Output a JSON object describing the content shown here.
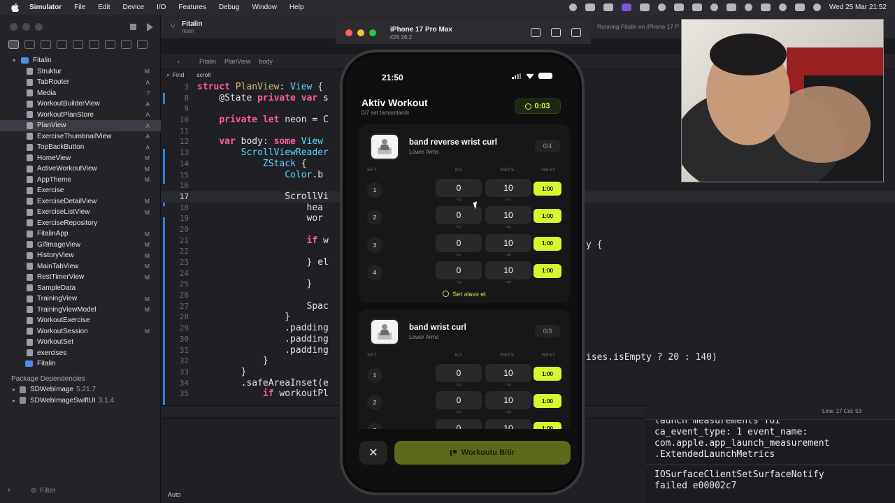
{
  "menubar": {
    "app": "Simulator",
    "items": [
      "File",
      "Edit",
      "Device",
      "I/O",
      "Features",
      "Debug",
      "Window",
      "Help"
    ],
    "clock": "Wed 25 Mar  21:52"
  },
  "xcode": {
    "scheme": "Fitalin",
    "branch": "main",
    "running_status": "Running Fitalin on iPhone 17 P",
    "find_label": "Find",
    "find_query": "scroll",
    "jump_path": [
      "Fitalin",
      "PlanView",
      "body"
    ],
    "project": "Fitalin",
    "files": [
      {
        "name": "Struktur",
        "badge": "M"
      },
      {
        "name": "TabRouter",
        "badge": "A"
      },
      {
        "name": "Media",
        "badge": "?"
      },
      {
        "name": "WorkoutBuilderView",
        "badge": "A"
      },
      {
        "name": "WorkoutPlanStore",
        "badge": "A"
      },
      {
        "name": "PlanView",
        "badge": "A"
      },
      {
        "name": "ExerciseThumbnailView",
        "badge": "A"
      },
      {
        "name": "TopBackButton",
        "badge": "A"
      },
      {
        "name": "HomeView",
        "badge": "M"
      },
      {
        "name": "ActiveWorkoutView",
        "badge": "M"
      },
      {
        "name": "AppTheme",
        "badge": "M"
      },
      {
        "name": "Exercise",
        "badge": ""
      },
      {
        "name": "ExerciseDetailView",
        "badge": "M"
      },
      {
        "name": "ExerciseListView",
        "badge": "M"
      },
      {
        "name": "ExerciseRepository",
        "badge": ""
      },
      {
        "name": "FitalinApp",
        "badge": "M"
      },
      {
        "name": "GifImageView",
        "badge": "M"
      },
      {
        "name": "HistoryView",
        "badge": "M"
      },
      {
        "name": "MainTabView",
        "badge": "M"
      },
      {
        "name": "RestTimerView",
        "badge": "M"
      },
      {
        "name": "SampleData",
        "badge": ""
      },
      {
        "name": "TrainingView",
        "badge": "M"
      },
      {
        "name": "TrainingViewModel",
        "badge": "M"
      },
      {
        "name": "WorkoutExercise",
        "badge": ""
      },
      {
        "name": "WorkoutSession",
        "badge": "M"
      },
      {
        "name": "WorkoutSet",
        "badge": ""
      },
      {
        "name": "exercises",
        "badge": ""
      },
      {
        "name": "Fitalin",
        "badge": ""
      }
    ],
    "packages_title": "Package Dependencies",
    "packages": [
      {
        "name": "SDWebImage",
        "version": "5.21.7"
      },
      {
        "name": "SDWebImageSwiftUI",
        "version": "3.1.4"
      }
    ],
    "filter_placeholder": "Filter",
    "auto_label": "Auto",
    "cursor_position": "Line: 17  Col: 53",
    "code": [
      {
        "n": "3",
        "t": "struct PlanView: View {"
      },
      {
        "n": "8",
        "t": "    @State private var s"
      },
      {
        "n": "9",
        "t": ""
      },
      {
        "n": "10",
        "t": "    private let neon = C"
      },
      {
        "n": "11",
        "t": ""
      },
      {
        "n": "12",
        "t": "    var body: some View"
      },
      {
        "n": "13",
        "t": "        ScrollViewReader"
      },
      {
        "n": "14",
        "t": "            ZStack {"
      },
      {
        "n": "15",
        "t": "                Color.b"
      },
      {
        "n": "16",
        "t": ""
      },
      {
        "n": "17",
        "t": "                ScrollVi"
      },
      {
        "n": "18",
        "t": "                    hea"
      },
      {
        "n": "19",
        "t": "                    wor"
      },
      {
        "n": "20",
        "t": ""
      },
      {
        "n": "21",
        "t": "                    if w"
      },
      {
        "n": "22",
        "t": ""
      },
      {
        "n": "23",
        "t": "                    } el"
      },
      {
        "n": "24",
        "t": ""
      },
      {
        "n": "25",
        "t": "                    }"
      },
      {
        "n": "26",
        "t": ""
      },
      {
        "n": "27",
        "t": "                    Spac"
      },
      {
        "n": "28",
        "t": "                }"
      },
      {
        "n": "29",
        "t": "                .padding"
      },
      {
        "n": "30",
        "t": "                .padding"
      },
      {
        "n": "31",
        "t": "                .padding"
      },
      {
        "n": "32",
        "t": "            }"
      },
      {
        "n": "33",
        "t": "        }"
      },
      {
        "n": "34",
        "t": "        .safeAreaInset(e"
      },
      {
        "n": "35",
        "t": "            if workoutPl"
      }
    ],
    "code_tail_21": "y {",
    "code_tail_31": "ises.isEmpty ? 20 : 140)"
  },
  "console": [
    "launch measurements TUI",
    "ca_event_type: 1 event_name:",
    "com.apple.app_launch_measurement",
    ".ExtendedLaunchMetrics",
    "IOSurfaceClientSetSurfaceNotify",
    "failed e00002c7"
  ],
  "simulator": {
    "device": "iPhone 17 Pro Max",
    "os": "iOS 26.2"
  },
  "app": {
    "status_time": "21:50",
    "title": "Aktiv Workout",
    "progress_text": "0/7 set tamamlandı",
    "timer": "0:03",
    "column_headers": {
      "set": "SET",
      "kg": "KG",
      "reps": "REPS",
      "rest": "REST"
    },
    "unit_kg": "kg",
    "unit_rep": "rep",
    "add_set_label": "Set əlavə et",
    "finish_label": "Workoutu Bitir",
    "close_label": "✕",
    "exercises": [
      {
        "name": "band reverse wrist curl",
        "muscle": "Lower Arms",
        "count": "0/4",
        "sets": [
          {
            "n": "1",
            "kg": "0",
            "reps": "10",
            "rest": "1:00"
          },
          {
            "n": "2",
            "kg": "0",
            "reps": "10",
            "rest": "1:00"
          },
          {
            "n": "3",
            "kg": "0",
            "reps": "10",
            "rest": "1:00"
          },
          {
            "n": "4",
            "kg": "0",
            "reps": "10",
            "rest": "1:00"
          }
        ]
      },
      {
        "name": "band wrist curl",
        "muscle": "Lower Arms",
        "count": "0/3",
        "sets": [
          {
            "n": "1",
            "kg": "0",
            "reps": "10",
            "rest": "1:00"
          },
          {
            "n": "2",
            "kg": "0",
            "reps": "10",
            "rest": "1:00"
          },
          {
            "n": "3",
            "kg": "0",
            "reps": "10",
            "rest": "1:00"
          }
        ]
      }
    ]
  }
}
